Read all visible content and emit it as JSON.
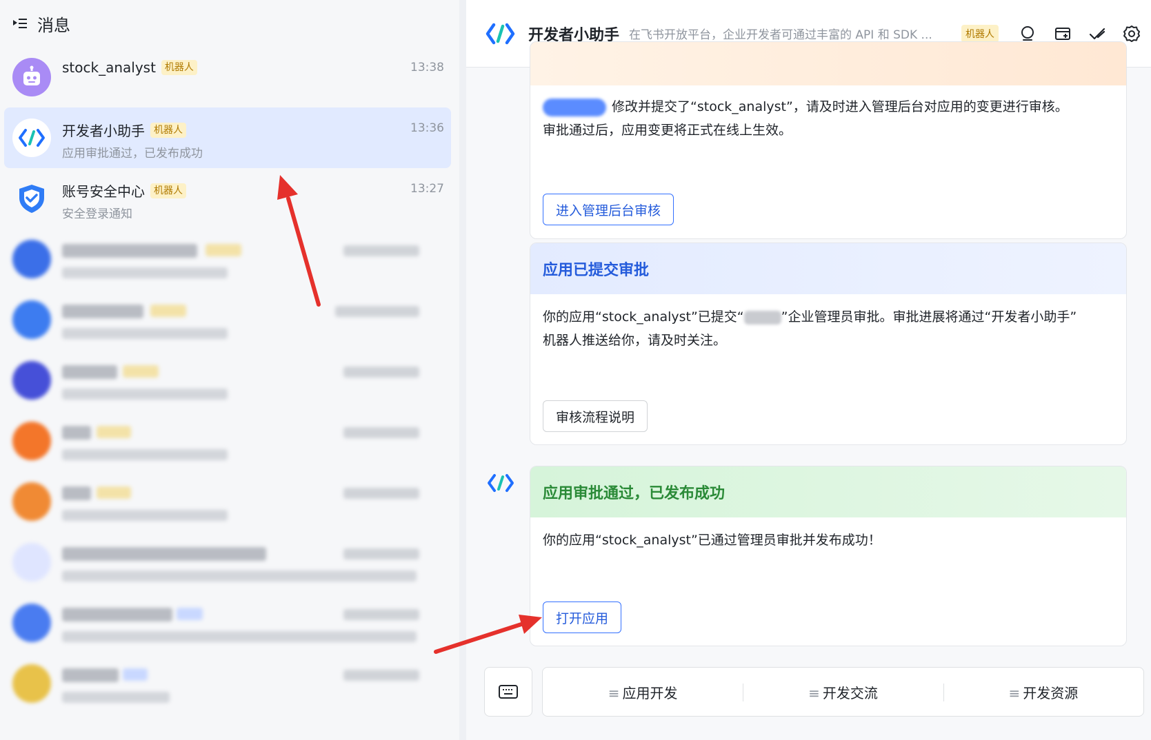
{
  "sidebar": {
    "title": "消息",
    "chats": [
      {
        "name": "stock_analyst",
        "tag": "机器人",
        "time": "13:38",
        "preview": ""
      },
      {
        "name": "开发者小助手",
        "tag": "机器人",
        "time": "13:36",
        "preview": "应用审批通过，已发布成功"
      },
      {
        "name": "账号安全中心",
        "tag": "机器人",
        "time": "13:27",
        "preview": "安全登录通知"
      }
    ]
  },
  "header": {
    "name": "开发者小助手",
    "description": "在飞书开放平台，企业开发者可通过丰富的 API 和 SDK ...",
    "tag": "机器人"
  },
  "messages": {
    "card1": {
      "text_a": "修改并提交了“stock_analyst”，请及时进入管理后台对应用的变更进行审核。",
      "text_b": "审批通过后，应用变更将正式在线上生效。",
      "button": "进入管理后台审核"
    },
    "card2": {
      "title": "应用已提交审批",
      "text_a": "你的应用“stock_analyst”已提交“",
      "text_b": "”企业管理员审批。审批进展将通过“开发者小助手”",
      "text_c": "机器人推送给你，请及时关注。",
      "button": "审核流程说明"
    },
    "card3": {
      "title": "应用审批通过，已发布成功",
      "text": "你的应用“stock_analyst”已通过管理员审批并发布成功！",
      "button": "打开应用"
    }
  },
  "bottom_menu": {
    "items": [
      "应用开发",
      "开发交流",
      "开发资源"
    ],
    "separator_glyph": "≡"
  },
  "colors": {
    "accent": "#3370ff",
    "submitted_header": "#e8efff",
    "approved_header": "#d9f5dc",
    "annotation_arrow": "#e5312c"
  }
}
